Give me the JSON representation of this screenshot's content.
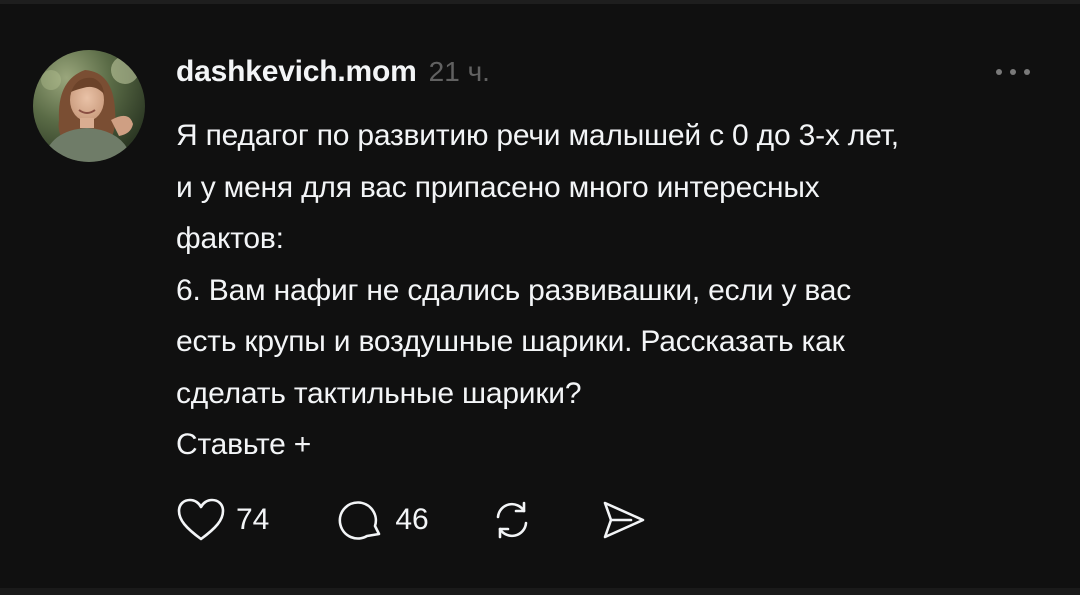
{
  "post": {
    "username": "dashkevich.mom",
    "timestamp": "21 ч.",
    "body_lines": [
      "Я педагог по развитию речи малышей с 0 до 3-х лет,",
      "и у меня для вас припасено много интересных",
      "фактов:",
      "6. Вам нафиг не сдались развивашки, если у вас",
      "есть крупы и воздушные шарики. Рассказать как",
      "сделать тактильные шарики?",
      "Ставьте +"
    ],
    "actions": {
      "like_count": "74",
      "comment_count": "46"
    }
  },
  "icons": {
    "more": "more-horizontal-icon",
    "like": "heart-icon",
    "comment": "speech-bubble-icon",
    "repost": "repost-arrows-icon",
    "share": "send-icon"
  },
  "colors": {
    "background": "#101010",
    "text_primary": "#f3f5f7",
    "text_secondary": "#616161"
  }
}
